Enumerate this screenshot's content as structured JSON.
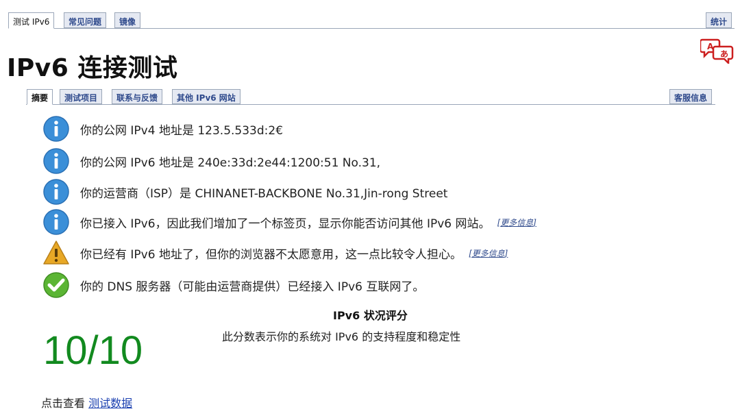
{
  "top_tabs": [
    {
      "label": "测试 IPv6",
      "active": true
    },
    {
      "label": "常见问题",
      "active": false
    },
    {
      "label": "镜像",
      "active": false
    }
  ],
  "top_right_tab": "统计",
  "page_title": "IPv6 连接测试",
  "translate_icon_glyphs": {
    "left": "A",
    "right": "あ"
  },
  "sub_tabs": [
    {
      "label": "摘要",
      "active": true
    },
    {
      "label": "测试项目",
      "active": false
    },
    {
      "label": "联系与反馈",
      "active": false
    },
    {
      "label": "其他 IPv6 网站",
      "active": false
    }
  ],
  "sub_right_tab": "客服信息",
  "results": [
    {
      "icon": "info-icon",
      "text": "你的公网 IPv4 地址是 123.5.533d:2€"
    },
    {
      "icon": "info-icon",
      "text": "你的公网 IPv6 地址是 240e:33d:2e44:1200:51 No.31,"
    },
    {
      "icon": "info-icon",
      "text": "你的运营商（ISP）是 CHINANET-BACKBONE No.31,Jin-rong Street"
    },
    {
      "icon": "info-icon",
      "text": "你已接入 IPv6，因此我们增加了一个标签页，显示你能否访问其他 IPv6 网站。",
      "more": "更多信息"
    },
    {
      "icon": "warning-icon",
      "text": "你已经有 IPv6 地址了，但你的浏览器不太愿意用，这一点比较令人担心。",
      "more": "更多信息"
    },
    {
      "icon": "check-icon",
      "text": "你的 DNS 服务器（可能由运营商提供）已经接入 IPv6 互联网了。"
    }
  ],
  "score": {
    "title": "IPv6 状况评分",
    "description": "此分数表示你的系统对 IPv6 的支持程度和稳定性",
    "value": "10/10"
  },
  "footer": {
    "prefix": "点击查看",
    "link": "测试数据"
  },
  "colors": {
    "accent": "#2f4a8c",
    "score_green": "#128a1f",
    "info_blue": "#3b8fd8",
    "warning": "#e8a826",
    "success": "#5bb534"
  }
}
